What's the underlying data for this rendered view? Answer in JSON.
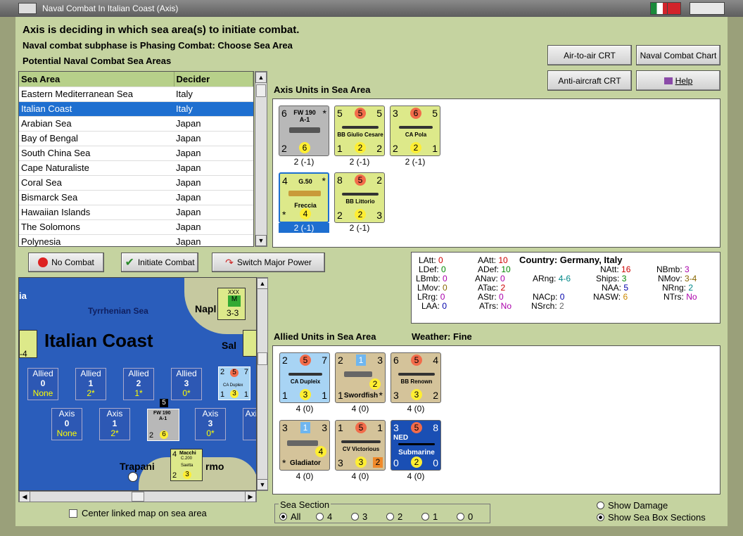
{
  "window": {
    "title": "Naval Combat In Italian Coast (Axis)"
  },
  "header": {
    "line1": "Axis is deciding in which sea area(s) to initiate combat.",
    "line2": "Naval combat subphase is Phasing Combat: Choose Sea Area",
    "line3": "Potential Naval Combat Sea Areas"
  },
  "table": {
    "col1": "Sea Area",
    "col2": "Decider",
    "rows": [
      [
        "Eastern Mediterranean Sea",
        "Italy"
      ],
      [
        "Italian Coast",
        "Italy"
      ],
      [
        "Arabian Sea",
        "Japan"
      ],
      [
        "Bay of Bengal",
        "Japan"
      ],
      [
        "South China Sea",
        "Japan"
      ],
      [
        "Cape Naturaliste",
        "Japan"
      ],
      [
        "Coral Sea",
        "Japan"
      ],
      [
        "Bismarck Sea",
        "Japan"
      ],
      [
        "Hawaiian Islands",
        "Japan"
      ],
      [
        "The Solomons",
        "Japan"
      ],
      [
        "Polynesia",
        "Japan"
      ]
    ]
  },
  "buttons": {
    "air_crt": "Air-to-air CRT",
    "naval_chart": "Naval Combat Chart",
    "aa_crt": "Anti-aircraft CRT",
    "help": "Help",
    "no_combat": "No Combat",
    "initiate": "Initiate Combat",
    "switch": "Switch Major Power"
  },
  "axis": {
    "title": "Axis Units in Sea Area",
    "units": [
      {
        "tl": "6",
        "tr": "*",
        "bl": "2",
        "bc": "6",
        "name": "FW 190",
        "name2": "A-1",
        "foot": "2 (-1)"
      },
      {
        "tl": "5",
        "tc": "5",
        "tr": "5",
        "bl": "1",
        "bc": "2",
        "br": "2",
        "name": "BB Giulio Cesare",
        "foot": "2 (-1)"
      },
      {
        "tl": "3",
        "tc": "6",
        "tr": "5",
        "bl": "2",
        "bc": "2",
        "br": "1",
        "name": "CA Pola",
        "foot": "2 (-1)"
      },
      {
        "tl": "4",
        "tr": "*",
        "bl": "*",
        "bc": "4",
        "name": "G.50",
        "name2": "Freccia",
        "foot": "2 (-1)"
      },
      {
        "tl": "8",
        "tc": "5",
        "tr": "2",
        "bl": "2",
        "bc": "2",
        "br": "3",
        "name": "BB Littorio",
        "foot": "2 (-1)"
      }
    ]
  },
  "stats": {
    "latt": "LAtt:",
    "latt_v": "0",
    "ldef": "LDef:",
    "ldef_v": "0",
    "lbmb": "LBmb:",
    "lbmb_v": "0",
    "lmov": "LMov:",
    "lmov_v": "0",
    "lrg": "LRrg:",
    "lrg_v": "0",
    "laa": "LAA:",
    "laa_v": "0",
    "aatt": "AAtt:",
    "aatt_v": "10",
    "adef": "ADef:",
    "adef_v": "10",
    "anav": "ANav:",
    "anav_v": "0",
    "atac": "ATac:",
    "atac_v": "2",
    "astr": "AStr:",
    "astr_v": "0",
    "atrs": "ATrs:",
    "atrs_v": "No",
    "country": "Country:",
    "country_v": "Germany, Italy",
    "arng": "ARng:",
    "arng_v": "4-6",
    "nacp": "NACp:",
    "nacp_v": "0",
    "nsrch": "NSrch:",
    "nsrch_v": "2",
    "natt": "NAtt:",
    "natt_v": "16",
    "ships": "Ships:",
    "ships_v": "3",
    "naa": "NAA:",
    "naa_v": "5",
    "nasw": "NASW:",
    "nasw_v": "6",
    "nbmb": "NBmb:",
    "nbmb_v": "3",
    "nmov": "NMov:",
    "nmov_v": "3-4",
    "nrng": "NRng:",
    "nrng_v": "2",
    "ntrs": "NTrs:",
    "ntrs_v": "No"
  },
  "allied": {
    "title": "Allied Units in Sea Area",
    "weather": "Weather:",
    "weather_v": "Fine",
    "units": [
      {
        "tl": "2",
        "tc": "5",
        "tr": "7",
        "bl": "1",
        "bc": "3",
        "br": "1",
        "name": "CA Dupleix",
        "foot": "4 (0)"
      },
      {
        "tl": "2",
        "tc": "1",
        "tr": "3",
        "bl": "1",
        "bc": "2",
        "br": "*",
        "name": "Swordfish",
        "foot": "4 (0)"
      },
      {
        "tl": "6",
        "tc": "5",
        "tr": "4",
        "bl": "3",
        "bc": "3",
        "br": "2",
        "name": "BB Renown",
        "foot": "4 (0)"
      },
      {
        "tl": "3",
        "tc": "1",
        "tr": "3",
        "bl": "*",
        "bc": "4",
        "name": "Gladiator",
        "foot": "4 (0)"
      },
      {
        "tl": "1",
        "tc": "5",
        "tr": "1",
        "bl": "3",
        "bc": "3",
        "br": "2",
        "name": "CV Victorious",
        "foot": "4 (0)"
      },
      {
        "tl": "3",
        "tc": "5",
        "tr": "8",
        "bl": "0",
        "bc": "2",
        "br": "0",
        "name": "Submarine",
        "tag": "NED",
        "foot": "4 (0)"
      }
    ]
  },
  "map": {
    "title": "Italian Coast",
    "sea_label": "Tyrrhenian Sea",
    "napl": "Napl",
    "sal": "Sal",
    "trapani": "Trapani",
    "rmo": "rmo",
    "ia": "ia",
    "side4": "-4",
    "xxx": "XXX",
    "xxx_val": "3-3",
    "xxx_m": "M",
    "sea_badge": "5",
    "allied_boxes": [
      {
        "h": "Allied",
        "n": "0",
        "s": "None"
      },
      {
        "h": "Allied",
        "n": "1",
        "s": "2*"
      },
      {
        "h": "Allied",
        "n": "2",
        "s": "1*"
      },
      {
        "h": "Allied",
        "n": "3",
        "s": "0*"
      }
    ],
    "axis_boxes": [
      {
        "h": "Axis",
        "n": "0",
        "s": "None"
      },
      {
        "h": "Axis",
        "n": "1",
        "s": "2*"
      },
      {
        "h": "Axis",
        "n": "3",
        "s": "0*"
      },
      {
        "h": "Axis",
        "n": "",
        "s": ""
      }
    ],
    "dup": {
      "tl": "2",
      "tc": "5",
      "tr": "7",
      "name": "CA Duplex",
      "bl": "1",
      "bc": "3",
      "br": "1"
    },
    "fw": {
      "name": "FW 190",
      "name2": "A-1",
      "bl": "2",
      "bc": "6"
    },
    "macchi": {
      "tl": "4",
      "name": "Macchi",
      "name2": "C.200",
      "name3": "Saetta",
      "bl": "2",
      "bc": "3"
    }
  },
  "center_linked": "Center linked map on sea area",
  "sea_section": {
    "label": "Sea Section",
    "options": [
      "All",
      "4",
      "3",
      "2",
      "1",
      "0"
    ]
  },
  "show_damage": "Show Damage",
  "show_sea": "Show Sea Box Sections"
}
